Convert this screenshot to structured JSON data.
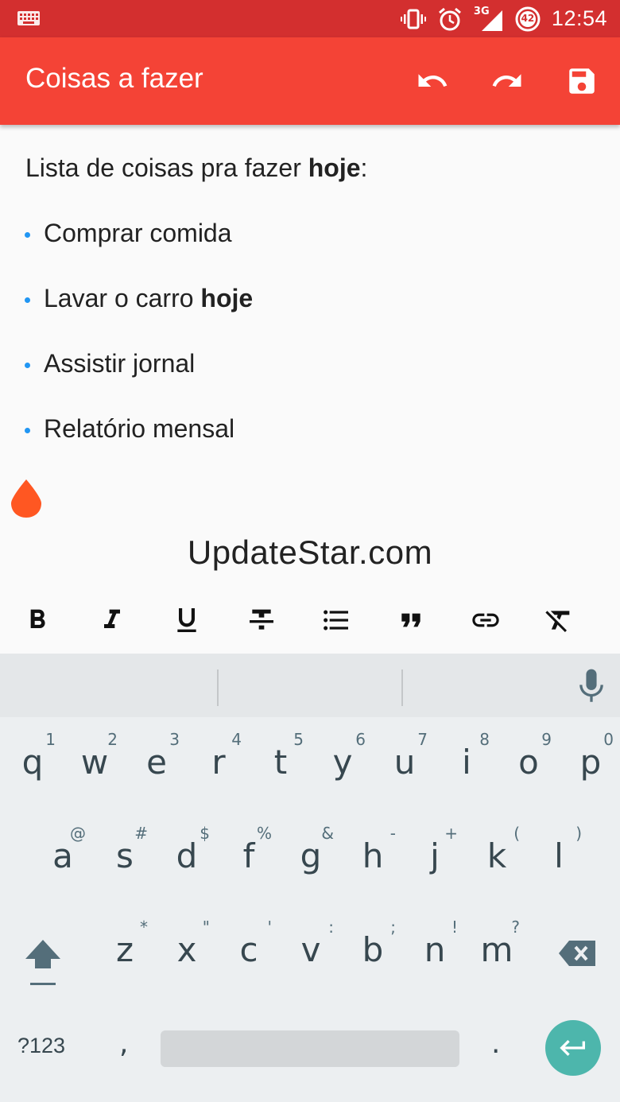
{
  "status_bar": {
    "time": "12:54",
    "network": "3G",
    "battery_level": "42",
    "icons": [
      "keyboard-icon",
      "vibrate-icon",
      "alarm-icon",
      "signal-icon",
      "battery-icon"
    ]
  },
  "app_bar": {
    "title": "Coisas a fazer",
    "actions": [
      "undo-icon",
      "redo-icon",
      "save-icon"
    ]
  },
  "editor": {
    "heading_prefix": "Lista de coisas pra fazer ",
    "heading_bold": "hoje",
    "heading_suffix": ":",
    "items": [
      {
        "text": "Comprar comida",
        "bold": ""
      },
      {
        "text": "Lavar o carro ",
        "bold": "hoje"
      },
      {
        "text": "Assistir jornal",
        "bold": ""
      },
      {
        "text": "Relatório mensal",
        "bold": ""
      }
    ],
    "watermark": "UpdateStar.com"
  },
  "format_toolbar": [
    "bold-icon",
    "italic-icon",
    "underline-icon",
    "strikethrough-icon",
    "bullet-list-icon",
    "quote-icon",
    "link-icon",
    "clear-format-icon"
  ],
  "keyboard": {
    "row1": [
      {
        "k": "q",
        "h": "1"
      },
      {
        "k": "w",
        "h": "2"
      },
      {
        "k": "e",
        "h": "3"
      },
      {
        "k": "r",
        "h": "4"
      },
      {
        "k": "t",
        "h": "5"
      },
      {
        "k": "y",
        "h": "6"
      },
      {
        "k": "u",
        "h": "7"
      },
      {
        "k": "i",
        "h": "8"
      },
      {
        "k": "o",
        "h": "9"
      },
      {
        "k": "p",
        "h": "0"
      }
    ],
    "row2": [
      {
        "k": "a",
        "h": "@"
      },
      {
        "k": "s",
        "h": "#"
      },
      {
        "k": "d",
        "h": "$"
      },
      {
        "k": "f",
        "h": "%"
      },
      {
        "k": "g",
        "h": "&"
      },
      {
        "k": "h",
        "h": "-"
      },
      {
        "k": "j",
        "h": "+"
      },
      {
        "k": "k",
        "h": "("
      },
      {
        "k": "l",
        "h": ")"
      }
    ],
    "row3": [
      {
        "k": "z",
        "h": "*"
      },
      {
        "k": "x",
        "h": "\""
      },
      {
        "k": "c",
        "h": "'"
      },
      {
        "k": "v",
        "h": ":"
      },
      {
        "k": "b",
        "h": ";"
      },
      {
        "k": "n",
        "h": "!"
      },
      {
        "k": "m",
        "h": "?"
      }
    ],
    "symbols_label": "?123",
    "comma": ",",
    "period": ".",
    "accent_color": "#4db6ac"
  },
  "colors": {
    "status_bar": "#d32f2f",
    "app_bar": "#f44336",
    "bullet": "#2196f3",
    "cursor_handle": "#ff5722"
  }
}
